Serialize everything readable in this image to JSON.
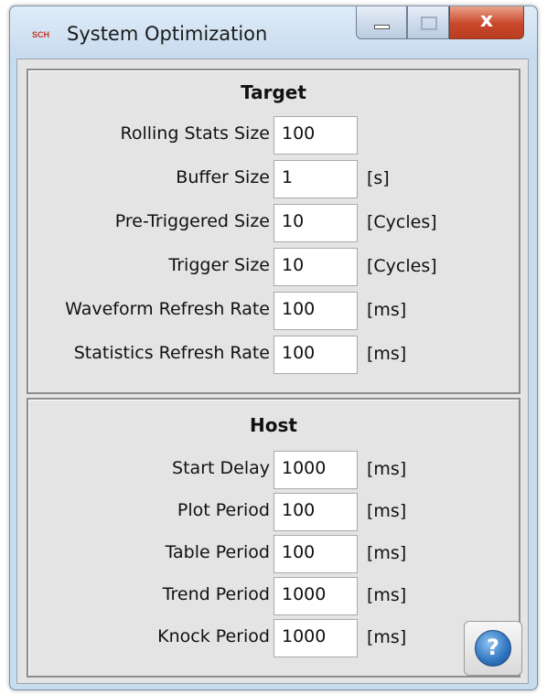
{
  "window": {
    "title": "System Optimization",
    "app_icon_text": "SCH",
    "close_glyph": "x"
  },
  "target": {
    "title": "Target",
    "fields": [
      {
        "label": "Rolling Stats Size",
        "value": "100",
        "unit": ""
      },
      {
        "label": "Buffer Size",
        "value": "1",
        "unit": "[s]"
      },
      {
        "label": "Pre-Triggered Size",
        "value": "10",
        "unit": "[Cycles]"
      },
      {
        "label": "Trigger Size",
        "value": "10",
        "unit": "[Cycles]"
      },
      {
        "label": "Waveform Refresh Rate",
        "value": "100",
        "unit": "[ms]"
      },
      {
        "label": "Statistics Refresh Rate",
        "value": "100",
        "unit": "[ms]"
      }
    ]
  },
  "host": {
    "title": "Host",
    "fields": [
      {
        "label": "Start Delay",
        "value": "1000",
        "unit": "[ms]"
      },
      {
        "label": "Plot Period",
        "value": "100",
        "unit": "[ms]"
      },
      {
        "label": "Table Period",
        "value": "100",
        "unit": "[ms]"
      },
      {
        "label": "Trend Period",
        "value": "1000",
        "unit": "[ms]"
      },
      {
        "label": "Knock Period",
        "value": "1000",
        "unit": "[ms]"
      }
    ]
  },
  "help_button": {
    "glyph": "?",
    "icon": "help-icon"
  },
  "colors": {
    "close_button": "#c9472a",
    "help_icon": "#2f74c0",
    "panel_background": "#e4e4e4"
  }
}
